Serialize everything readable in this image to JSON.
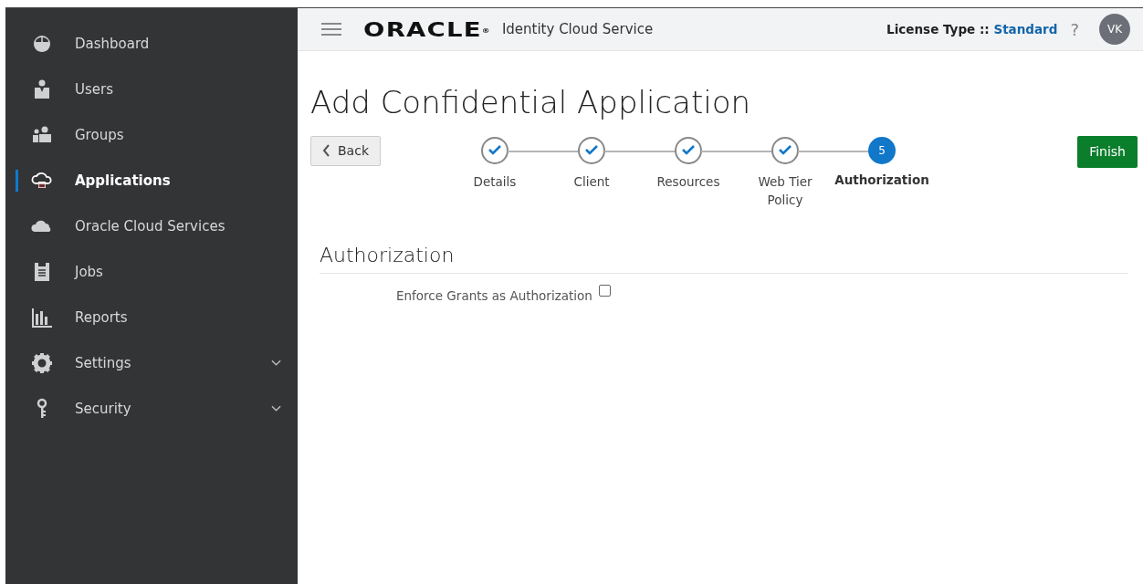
{
  "sidebar": {
    "items": [
      {
        "label": "Dashboard",
        "selected": false,
        "expandable": false
      },
      {
        "label": "Users",
        "selected": false,
        "expandable": false
      },
      {
        "label": "Groups",
        "selected": false,
        "expandable": false
      },
      {
        "label": "Applications",
        "selected": true,
        "expandable": false
      },
      {
        "label": "Oracle Cloud Services",
        "selected": false,
        "expandable": false
      },
      {
        "label": "Jobs",
        "selected": false,
        "expandable": false
      },
      {
        "label": "Reports",
        "selected": false,
        "expandable": false
      },
      {
        "label": "Settings",
        "selected": false,
        "expandable": true
      },
      {
        "label": "Security",
        "selected": false,
        "expandable": true
      }
    ]
  },
  "header": {
    "logo": "ORACLE",
    "logo_mark": "®",
    "product": "Identity Cloud Service",
    "license_label": "License Type ::",
    "license_value": "Standard",
    "help": "?",
    "avatar": "VK"
  },
  "page": {
    "title": "Add Confidential Application",
    "back_button": "Back",
    "finish_button": "Finish",
    "steps": [
      {
        "label": "Details",
        "completed": true,
        "selected": false
      },
      {
        "label": "Client",
        "completed": true,
        "selected": false
      },
      {
        "label": "Resources",
        "completed": true,
        "selected": false
      },
      {
        "label": "Web Tier Policy",
        "completed": true,
        "selected": false
      },
      {
        "label": "Authorization",
        "number": "5",
        "completed": false,
        "selected": true
      }
    ],
    "section": {
      "title": "Authorization",
      "fields": [
        {
          "label": "Enforce Grants as Authorization",
          "checked": false
        }
      ]
    }
  }
}
